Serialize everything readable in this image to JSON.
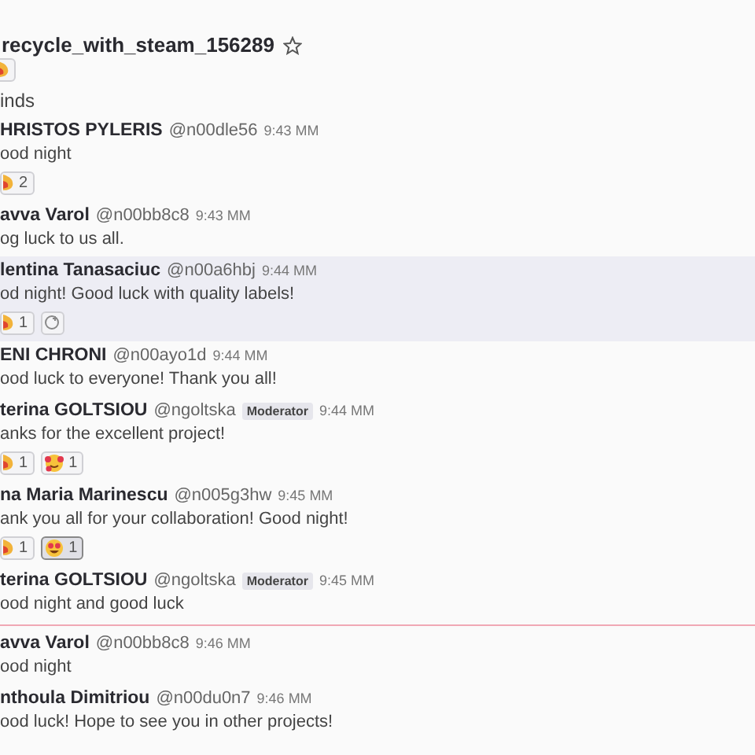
{
  "header": {
    "title": "recycle_with_steam_156289",
    "starred": false
  },
  "feed": [
    {
      "kind": "reactions",
      "reactions": [
        {
          "kind": "party",
          "selected": false
        }
      ]
    },
    {
      "kind": "text",
      "text": "inds"
    },
    {
      "kind": "message",
      "name": "HRISTOS PYLERIS",
      "handle": "@n00dle56",
      "time": "9:43 MM",
      "text": "ood night",
      "highlighted": false,
      "reactions": [
        {
          "kind": "party",
          "count": "2",
          "selected": false
        }
      ]
    },
    {
      "kind": "message",
      "name": "avva Varol",
      "handle": "@n00bb8c8",
      "time": "9:43 MM",
      "text": "og luck to us all.",
      "highlighted": false
    },
    {
      "kind": "message",
      "name": "lentina Tanasaciuc",
      "handle": "@n00a6hbj",
      "time": "9:44 MM",
      "text": "od night! Good luck with quality labels!",
      "highlighted": true,
      "add_reaction": true,
      "reactions": [
        {
          "kind": "party",
          "count": "1",
          "selected": false
        }
      ]
    },
    {
      "kind": "message",
      "name": "ENI CHRONI",
      "handle": "@n00ayo1d",
      "time": "9:44 MM",
      "text": "ood luck to everyone! Thank you all!",
      "highlighted": false
    },
    {
      "kind": "message",
      "name": "terina GOLTSIOU",
      "handle": "@ngoltska",
      "badge": "Moderator",
      "time": "9:44 MM",
      "text": "anks for the excellent project!",
      "highlighted": false,
      "reactions": [
        {
          "kind": "party",
          "count": "1",
          "selected": false
        },
        {
          "kind": "hearts",
          "count": "1",
          "selected": false
        }
      ]
    },
    {
      "kind": "message",
      "name": "na Maria Marinescu",
      "handle": "@n005g3hw",
      "time": "9:45 MM",
      "text": "ank you all for your collaboration! Good night!",
      "highlighted": false,
      "reactions": [
        {
          "kind": "party",
          "count": "1",
          "selected": false
        },
        {
          "kind": "heart-eyes",
          "count": "1",
          "selected": true
        }
      ]
    },
    {
      "kind": "message",
      "name": "terina GOLTSIOU",
      "handle": "@ngoltska",
      "badge": "Moderator",
      "time": "9:45 MM",
      "text": "ood night and good luck",
      "highlighted": false
    },
    {
      "kind": "divider"
    },
    {
      "kind": "message",
      "name": "avva Varol",
      "handle": "@n00bb8c8",
      "time": "9:46 MM",
      "text": "ood night",
      "highlighted": false
    },
    {
      "kind": "message",
      "name": "nthoula Dimitriou",
      "handle": "@n00du0n7",
      "time": "9:46 MM",
      "text": "ood luck! Hope to see you in other projects!",
      "highlighted": false
    }
  ]
}
